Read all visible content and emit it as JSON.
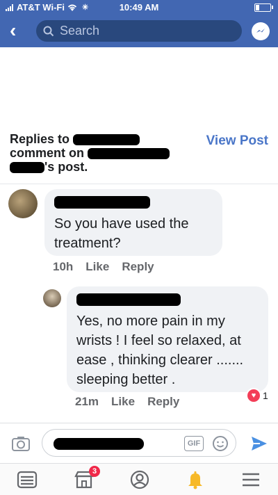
{
  "status_bar": {
    "carrier": "AT&T Wi-Fi",
    "time": "10:49 AM"
  },
  "nav": {
    "search_placeholder": "Search"
  },
  "header": {
    "title_part1": "Replies to",
    "title_part2": "comment on",
    "title_part3": "'s post.",
    "view_post_label": "View Post"
  },
  "comments": [
    {
      "text": "So you have used the treatment?",
      "time": "10h",
      "like_label": "Like",
      "reply_label": "Reply"
    },
    {
      "text": "Yes,  no more pain in my wrists ! I feel so relaxed, at ease , thinking clearer ....... sleeping better .",
      "time": "21m",
      "like_label": "Like",
      "reply_label": "Reply",
      "reaction_count": "1"
    }
  ],
  "composer": {
    "gif_label": "GIF"
  },
  "tabbar": {
    "marketplace_badge": "3"
  },
  "colors": {
    "brand": "#4267b2",
    "link": "#4a76c8",
    "bubble": "#f0f2f5",
    "heart": "#f33e58",
    "notification_bell": "#f7b928"
  }
}
